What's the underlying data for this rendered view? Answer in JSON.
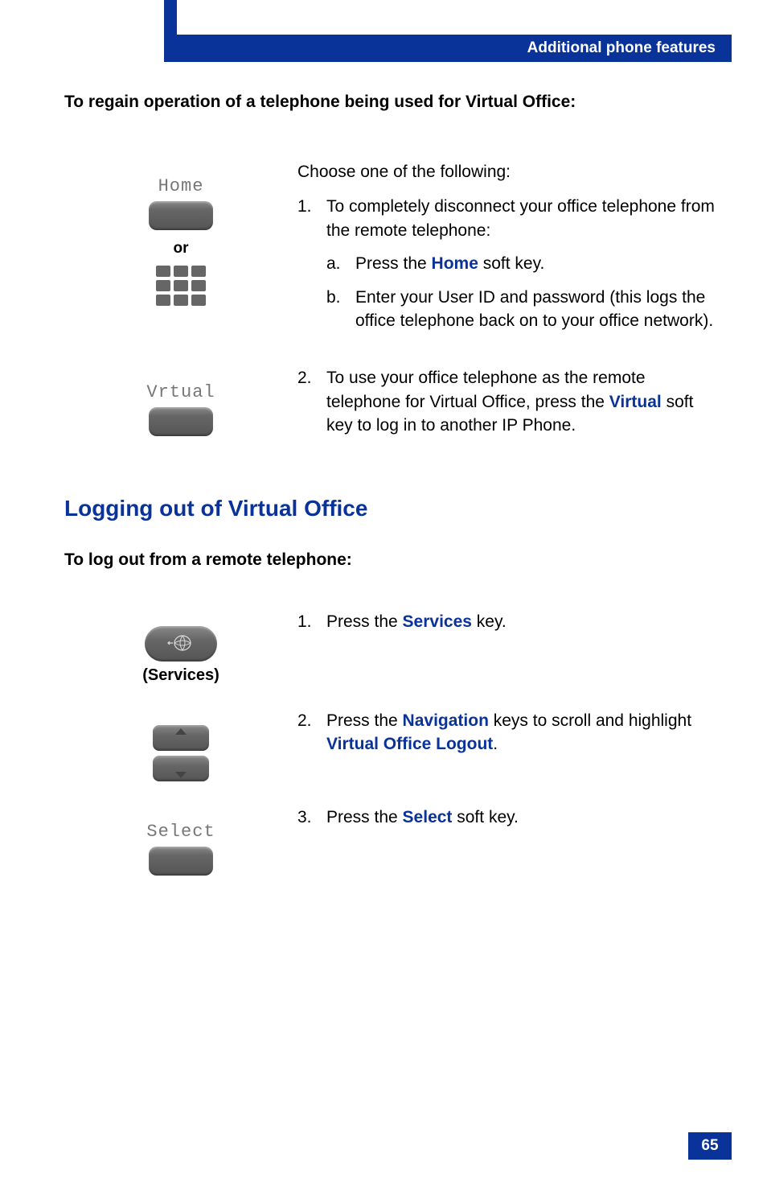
{
  "header": {
    "title": "Additional phone features"
  },
  "section1": {
    "heading": "To regain operation of a telephone being used for Virtual Office:",
    "intro": "Choose one of the following:",
    "item1": {
      "num": "1.",
      "text": "To completely disconnect your office telephone from the remote telephone:",
      "sub_a": {
        "num": "a.",
        "before": "Press the ",
        "key": "Home",
        "after": " soft key."
      },
      "sub_b": {
        "num": "b.",
        "text": "Enter your User ID and password (this logs the office telephone back on to your office network)."
      }
    },
    "item2": {
      "num": "2.",
      "before": "To use your office telephone as the remote telephone for Virtual Office, press the ",
      "key": "Virtual",
      "after": " soft key to log in to another IP Phone."
    },
    "softkey_home_label": "Home",
    "or_label": "or",
    "softkey_virtual_label": "Vrtual"
  },
  "section2": {
    "title": "Logging out of Virtual Office",
    "heading": "To log out from a remote telephone:",
    "services_label": "(Services)",
    "step1": {
      "num": "1.",
      "before": "Press the ",
      "key": "Services",
      "after": " key."
    },
    "step2": {
      "num": "2.",
      "before": "Press the ",
      "key1": "Navigation",
      "mid": " keys to scroll and highlight ",
      "key2": "Virtual Office Logout",
      "after": "."
    },
    "step3": {
      "num": "3.",
      "before": "Press the ",
      "key": "Select",
      "after": " soft key."
    },
    "softkey_select_label": "Select"
  },
  "page_number": "65"
}
